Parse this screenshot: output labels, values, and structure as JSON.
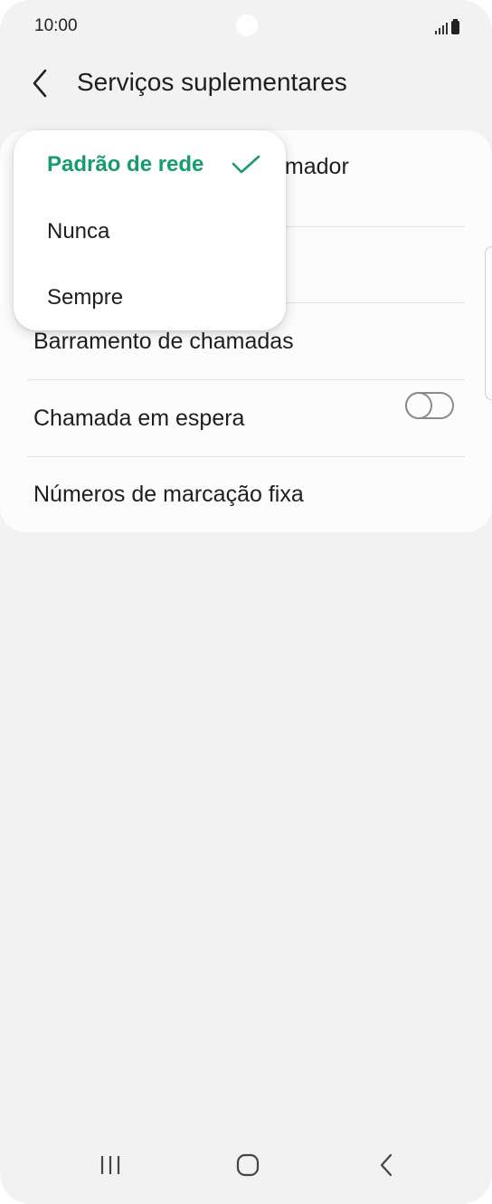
{
  "status_bar": {
    "time": "10:00"
  },
  "header": {
    "title": "Serviços suplementares"
  },
  "settings": {
    "row1_label_visible": "amador",
    "row3_label": "Barramento de chamadas",
    "row4_label": "Chamada em espera",
    "row4_toggle_on": false,
    "row5_label": "Números de marcação fixa"
  },
  "dropdown": {
    "options": [
      {
        "label": "Padrão de rede",
        "selected": true
      },
      {
        "label": "Nunca",
        "selected": false
      },
      {
        "label": "Sempre",
        "selected": false
      }
    ]
  },
  "colors": {
    "accent": "#179c6c",
    "background": "#f2f2f2",
    "card": "#fcfcfc"
  },
  "icons": {
    "back": "chevron-left-icon",
    "check": "check-icon",
    "nav_recent": "recent-apps-icon",
    "nav_home": "home-icon",
    "nav_back": "back-icon"
  }
}
